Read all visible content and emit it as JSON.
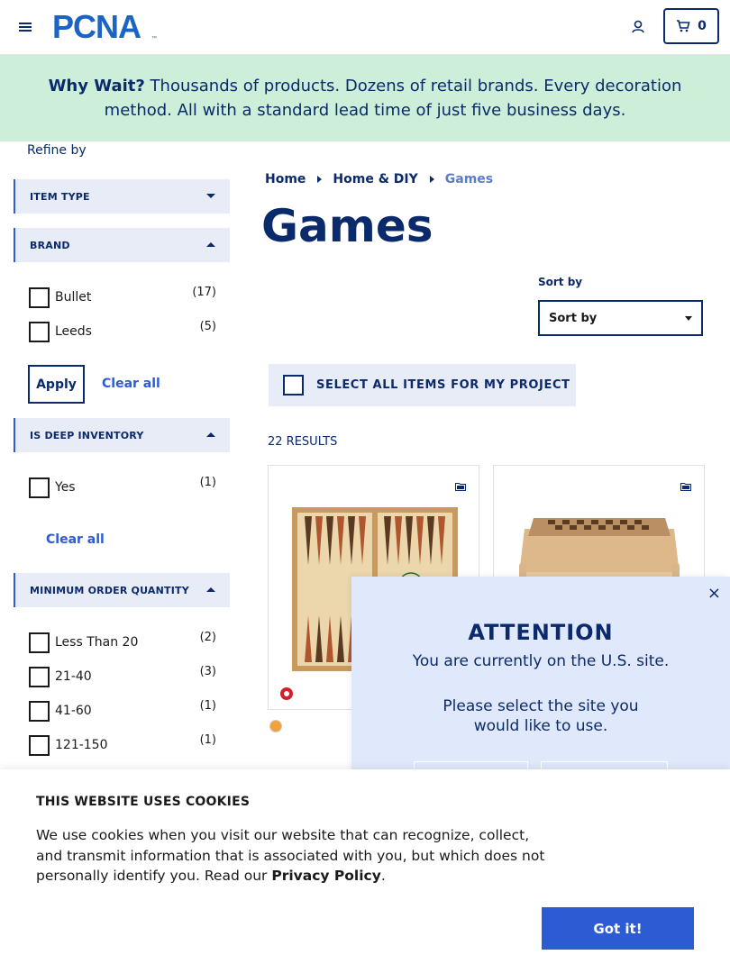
{
  "header": {
    "brand": "PCNA",
    "cart_count": "0"
  },
  "promo": {
    "lead": "Why Wait?",
    "text": "Thousands of products. Dozens of retail brands. Every decoration method. All with a standard lead time of just five business days."
  },
  "sidebar": {
    "refine_label": "Refine by",
    "facets": {
      "item_type": {
        "label": "ITEM TYPE"
      },
      "brand": {
        "label": "BRAND",
        "options": [
          {
            "label": "Bullet",
            "count": "(17)"
          },
          {
            "label": "Leeds",
            "count": "(5)"
          }
        ],
        "apply_label": "Apply",
        "clear_label": "Clear all"
      },
      "deep_inventory": {
        "label": "IS DEEP INVENTORY",
        "options": [
          {
            "label": "Yes",
            "count": "(1)"
          }
        ],
        "clear_label": "Clear all"
      },
      "min_order": {
        "label": "MINIMUM ORDER QUANTITY",
        "options": [
          {
            "label": "Less Than 20",
            "count": "(2)"
          },
          {
            "label": "21-40",
            "count": "(3)"
          },
          {
            "label": "41-60",
            "count": "(1)"
          },
          {
            "label": "121-150",
            "count": "(1)"
          }
        ]
      }
    }
  },
  "main": {
    "breadcrumb": [
      "Home",
      "Home & DIY",
      "Games"
    ],
    "title": "Games",
    "sort": {
      "label": "Sort by",
      "value": "Sort by"
    },
    "select_all_label": "SELECT ALL ITEMS FOR MY PROJECT",
    "results_label": "22 RESULTS",
    "colors": {
      "navy": "#0a2a6b",
      "accent": "#2d5bd4",
      "promo_bg": "#cdeed9"
    }
  },
  "modal": {
    "title": "ATTENTION",
    "line1": "You are currently on the U.S. site.",
    "line2": "Please select the site you would like to use.",
    "close": "×"
  },
  "cookie": {
    "title": "THIS WEBSITE USES COOKIES",
    "body": "We use cookies when you visit our website that can recognize, collect, and transmit information that is associated with you, but which does not personally identify you. Read our ",
    "link": "Privacy Policy",
    "end": ".",
    "button": "Got it!"
  }
}
